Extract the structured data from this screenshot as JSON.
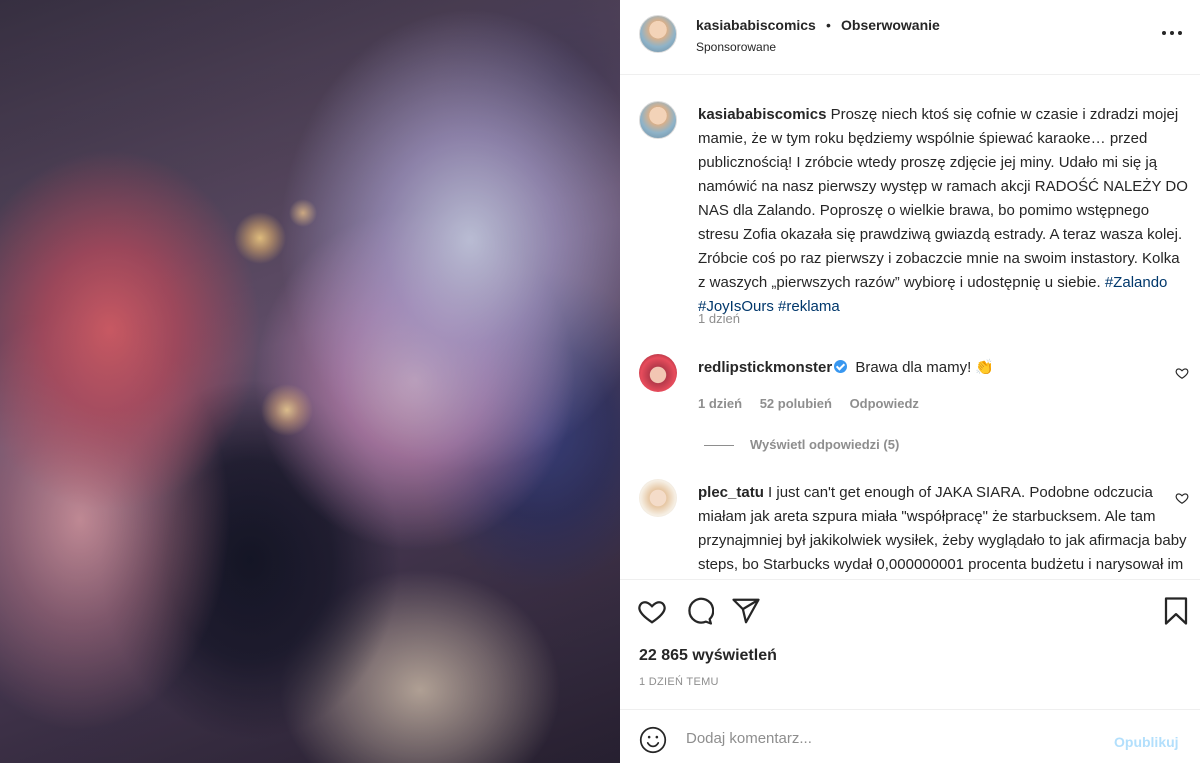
{
  "post": {
    "username": "kasiababiscomics",
    "separator": "•",
    "follow_label": "Obserwowanie",
    "sponsored_label": "Sponsorowane",
    "more_icon": "more-options-icon"
  },
  "caption": {
    "username": "kasiababiscomics",
    "text": " Proszę niech ktoś się cofnie w czasie i zdradzi mojej mamie, że w tym roku będziemy wspólnie śpiewać karaoke… przed publicznością! I zróbcie wtedy proszę zdjęcie jej miny. Udało mi się ją namówić na nasz pierwszy występ w ramach akcji RADOŚĆ NALEŻY DO NAS dla Zalando. Poproszę o wielkie brawa, bo pomimo wstępnego stresu Zofia okazała się prawdziwą gwiazdą estrady. A teraz wasza kolej. Zróbcie coś po raz pierwszy i zobaczcie mnie na swoim instastory. Kolka z waszych „pierwszych razów” wybiorę i udostępnię u siebie. ",
    "hashtags": [
      "#Zalando",
      "#JoyIsOurs",
      "#reklama"
    ],
    "time": "1 dzień"
  },
  "comments": [
    {
      "username": "redlipstickmonster",
      "verified": true,
      "text": " Brawa dla mamy! 👏",
      "time": "1 dzień",
      "likes": "52 polubień",
      "reply_label": "Odpowiedz",
      "view_replies": "Wyświetl odpowiedzi (5)"
    },
    {
      "username": "plec_tatu",
      "text": " I just can't get enough of JAKA SIARA. Podobne odczucia miałam jak areta szpura miała \"współpracę\" że starbucksem. Ale tam przynajmniej był jakikolwiek wysiłek, żeby wyglądało to jak afirmacja baby steps, bo Starbucks wydał 0,000000001 procenta budżetu i narysował im głupi lew..."
    }
  ],
  "stats": {
    "views": "22 865 wyświetleń",
    "date": "1 DZIEŃ TEMU"
  },
  "add_comment": {
    "placeholder": "Dodaj komentarz...",
    "publish_label": "Opublikuj"
  },
  "colors": {
    "text": "#262626",
    "secondary": "#8e8e8e",
    "hashtag": "#00376b",
    "verified": "#3897f0",
    "publish_disabled": "#b2dffc",
    "border": "#efefef"
  }
}
